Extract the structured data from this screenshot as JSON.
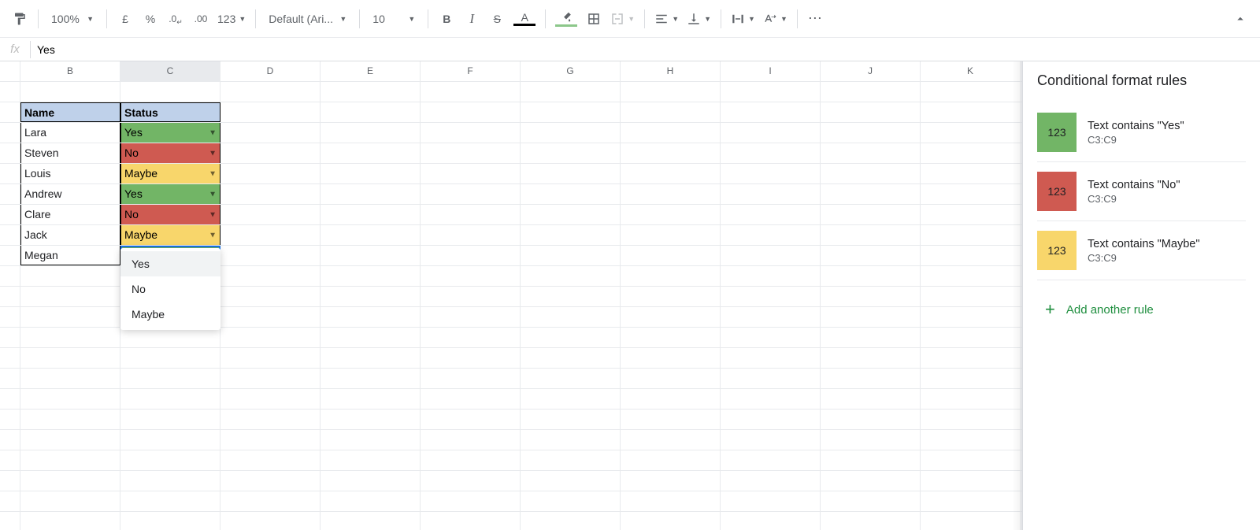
{
  "toolbar": {
    "zoom": "100%",
    "currency_symbol": "£",
    "percent_symbol": "%",
    "dec_decrease": ".0",
    "dec_increase": ".00",
    "num_format": "123",
    "font_name": "Default (Ari...",
    "font_size": "10",
    "more": "⋯"
  },
  "formula_bar": {
    "fx": "fx",
    "value": "Yes"
  },
  "columns": [
    "B",
    "C",
    "D",
    "E",
    "F",
    "G",
    "H",
    "I",
    "J",
    "K"
  ],
  "table": {
    "headers": {
      "name": "Name",
      "status": "Status"
    },
    "rows": [
      {
        "name": "Lara",
        "status": "Yes",
        "class": "yes"
      },
      {
        "name": "Steven",
        "status": "No",
        "class": "no"
      },
      {
        "name": "Louis",
        "status": "Maybe",
        "class": "maybe"
      },
      {
        "name": "Andrew",
        "status": "Yes",
        "class": "yes"
      },
      {
        "name": "Clare",
        "status": "No",
        "class": "no"
      },
      {
        "name": "Jack",
        "status": "Maybe",
        "class": "maybe"
      },
      {
        "name": "Megan",
        "status": "Yes",
        "class": "yes",
        "active": true
      }
    ]
  },
  "dropdown": {
    "options": [
      "Yes",
      "No",
      "Maybe"
    ],
    "hover_index": 0
  },
  "sidebar": {
    "title": "Conditional format rules",
    "swatch_text": "123",
    "rules": [
      {
        "text": "Text contains \"Yes\"",
        "range": "C3:C9",
        "swatch": "green"
      },
      {
        "text": "Text contains \"No\"",
        "range": "C3:C9",
        "swatch": "red"
      },
      {
        "text": "Text contains \"Maybe\"",
        "range": "C3:C9",
        "swatch": "yellow"
      }
    ],
    "add_label": "Add another rule"
  }
}
